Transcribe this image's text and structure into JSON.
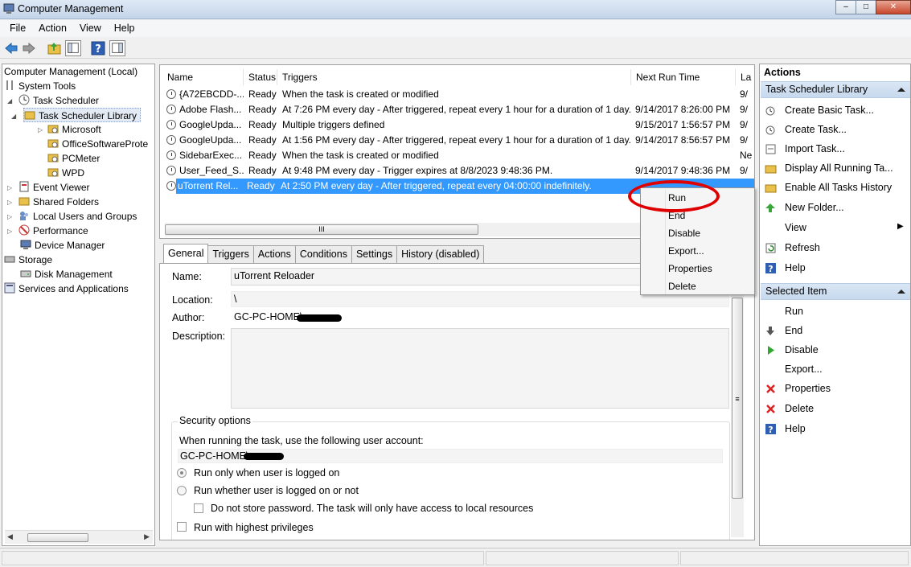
{
  "window": {
    "title": "Computer Management"
  },
  "menubar": [
    "File",
    "Action",
    "View",
    "Help"
  ],
  "tree": {
    "root": "Computer Management (Local)",
    "items": [
      {
        "label": "System Tools"
      },
      {
        "label": "Task Scheduler"
      },
      {
        "label": "Task Scheduler Library"
      },
      {
        "label": "Microsoft"
      },
      {
        "label": "OfficeSoftwareProte"
      },
      {
        "label": "PCMeter"
      },
      {
        "label": "WPD"
      },
      {
        "label": "Event Viewer"
      },
      {
        "label": "Shared Folders"
      },
      {
        "label": "Local Users and Groups"
      },
      {
        "label": "Performance"
      },
      {
        "label": "Device Manager"
      },
      {
        "label": "Storage"
      },
      {
        "label": "Disk Management"
      },
      {
        "label": "Services and Applications"
      }
    ]
  },
  "tasklist": {
    "columns": [
      "Name",
      "Status",
      "Triggers",
      "Next Run Time",
      "La"
    ],
    "rows": [
      {
        "name": "{A72EBCDD-...",
        "status": "Ready",
        "triggers": "When the task is created or modified",
        "next": "",
        "last": "9/"
      },
      {
        "name": "Adobe Flash...",
        "status": "Ready",
        "triggers": "At 7:26 PM every day - After triggered, repeat every 1 hour for a duration of 1 day.",
        "next": "9/14/2017 8:26:00 PM",
        "last": "9/"
      },
      {
        "name": "GoogleUpda...",
        "status": "Ready",
        "triggers": "Multiple triggers defined",
        "next": "9/15/2017 1:56:57 PM",
        "last": "9/"
      },
      {
        "name": "GoogleUpda...",
        "status": "Ready",
        "triggers": "At 1:56 PM every day - After triggered, repeat every 1 hour for a duration of 1 day.",
        "next": "9/14/2017 8:56:57 PM",
        "last": "9/"
      },
      {
        "name": "SidebarExec...",
        "status": "Ready",
        "triggers": "When the task is created or modified",
        "next": "",
        "last": "Ne"
      },
      {
        "name": "User_Feed_S...",
        "status": "Ready",
        "triggers": "At 9:48 PM every day - Trigger expires at 8/8/2023 9:48:36 PM.",
        "next": "9/14/2017 9:48:36 PM",
        "last": "9/"
      },
      {
        "name": "uTorrent Rel...",
        "status": "Ready",
        "triggers": "At 2:50 PM every day - After triggered, repeat every 04:00:00 indefinitely.",
        "next": "",
        "last": ""
      }
    ],
    "scroll_thumb_label": "III"
  },
  "tabs": [
    "General",
    "Triggers",
    "Actions",
    "Conditions",
    "Settings",
    "History (disabled)"
  ],
  "general": {
    "name_label": "Name:",
    "name_value": "uTorrent Reloader",
    "location_label": "Location:",
    "location_value": "\\",
    "author_label": "Author:",
    "author_value": "GC-PC-HOME\\",
    "description_label": "Description:",
    "security_title": "Security options",
    "account_prompt": "When running the task, use the following user account:",
    "account_value": "GC-PC-HOME\\",
    "radio_logged_on": "Run only when user is logged on",
    "radio_whether": "Run whether user is logged on or not",
    "no_store_pw": "Do not store password.  The task will only have access to local resources",
    "highest_priv": "Run with highest privileges"
  },
  "context_menu": [
    "Run",
    "End",
    "Disable",
    "Export...",
    "Properties",
    "Delete"
  ],
  "actions_pane": {
    "title": "Actions",
    "section1": "Task Scheduler Library",
    "items1": [
      "Create Basic Task...",
      "Create Task...",
      "Import Task...",
      "Display All Running Ta...",
      "Enable All Tasks History",
      "New Folder...",
      "View",
      "Refresh",
      "Help"
    ],
    "section2": "Selected Item",
    "items2": [
      "Run",
      "End",
      "Disable",
      "Export...",
      "Properties",
      "Delete",
      "Help"
    ]
  },
  "colors": {
    "selection": "#3399ff",
    "highlight_circle": "#e00000",
    "section_header": "#c7d9ee"
  }
}
